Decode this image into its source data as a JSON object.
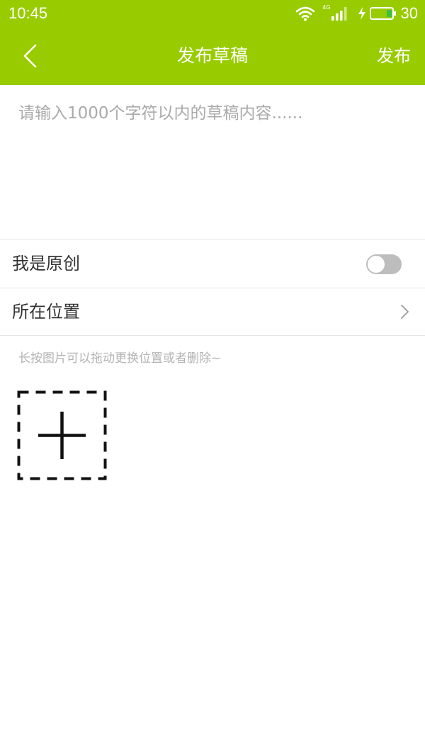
{
  "status_bar": {
    "time": "10:45",
    "network_label": "4G",
    "battery_level": "30",
    "icons": [
      "wifi-icon",
      "signal-icon",
      "charging-icon",
      "battery-icon"
    ]
  },
  "header": {
    "title": "发布草稿",
    "publish_label": "发布",
    "back_icon": "chevron-left-icon"
  },
  "editor": {
    "placeholder": "请输入1000个字符以内的草稿内容......",
    "value": ""
  },
  "options": {
    "original_label": "我是原创",
    "original_enabled": false,
    "location_label": "所在位置"
  },
  "images": {
    "hint": "长按图片可以拖动更换位置或者删除~",
    "add_icon": "plus-icon"
  },
  "colors": {
    "accent": "#99cc00",
    "toggle_off": "#bdbdbd",
    "hint_text": "#b3b3b3",
    "divider": "#e6e6e6"
  }
}
